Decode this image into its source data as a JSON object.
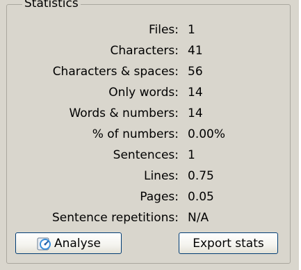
{
  "group": {
    "title": "Statistics"
  },
  "stats": [
    {
      "label": "Files:",
      "value": "1"
    },
    {
      "label": "Characters:",
      "value": "41"
    },
    {
      "label": "Characters & spaces:",
      "value": "56"
    },
    {
      "label": "Only words:",
      "value": "14"
    },
    {
      "label": "Words & numbers:",
      "value": "14"
    },
    {
      "label": "% of numbers:",
      "value": "0.00%"
    },
    {
      "label": "Sentences:",
      "value": "1"
    },
    {
      "label": "Lines:",
      "value": "0.75"
    },
    {
      "label": "Pages:",
      "value": "0.05"
    },
    {
      "label": "Sentence repetitions:",
      "value": "N/A"
    }
  ],
  "buttons": {
    "analyse_label": "Analyse",
    "analyse_icon": "analyse-gauge-icon",
    "export_label": "Export stats"
  },
  "colors": {
    "background": "#d9d6cd",
    "button_border": "#003c74",
    "icon_accent": "#3b8ed8"
  }
}
